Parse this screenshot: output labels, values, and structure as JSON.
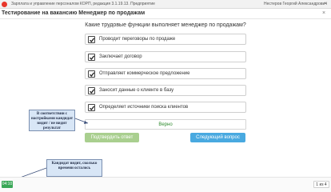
{
  "window": {
    "app_title": "Зарплата и управление персоналом КОРП, редакция 3.1.19.13. Предприятие",
    "user_name": "Нестеров Георгий Александрович",
    "close_symbol": "×"
  },
  "document": {
    "title": "Тестирование на вакансию Менеджер по продажам",
    "close_symbol": "×"
  },
  "test": {
    "question": "Какие трудовые функции выполняет менеджер по продажам?",
    "options": [
      {
        "label": "Проводит переговоры по продаже",
        "checked": true
      },
      {
        "label": "Заключает договор",
        "checked": true
      },
      {
        "label": "Отправляет коммерческое предложение",
        "checked": true
      },
      {
        "label": "Заносит данные о клиенте в базу",
        "checked": true
      },
      {
        "label": "Определяет источники поиска клиентов",
        "checked": true
      }
    ],
    "result": "Верно",
    "confirm_button": "Подтвердить ответ",
    "next_button": "Следующий вопрос"
  },
  "annotations": {
    "result_note": "В соответствии с настройками кандидат видит / не видит результат",
    "timer_note": "Кандидат видит, сколько времени осталось"
  },
  "footer": {
    "timer": "04:10",
    "question_counter": "1 из 4"
  },
  "colors": {
    "logo": "#e8372c",
    "result_text": "#2e8b2e",
    "confirm_button": "#a9cf8f",
    "next_button": "#49a9e0",
    "timer": "#3aa757",
    "annotation_fill": "#d8e6f6"
  }
}
